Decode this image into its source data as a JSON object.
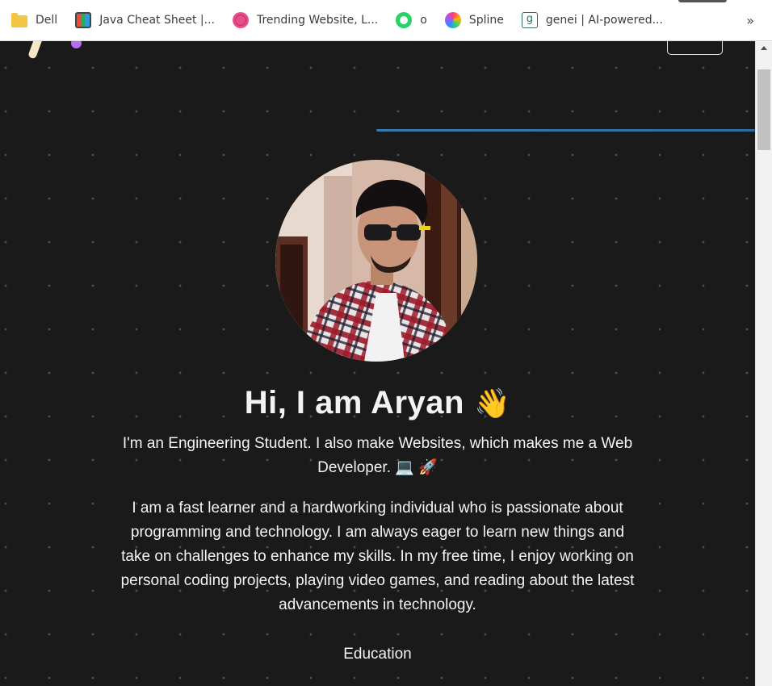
{
  "bookmarks_bar": {
    "items": [
      {
        "label": "Dell",
        "icon": "folder-icon"
      },
      {
        "label": "Java Cheat Sheet |...",
        "icon": "java-icon"
      },
      {
        "label": "Trending Website, L...",
        "icon": "dribbble-icon"
      },
      {
        "label": "o",
        "icon": "whatsapp-icon"
      },
      {
        "label": "Spline",
        "icon": "spline-icon"
      },
      {
        "label": "genei | AI-powered...",
        "icon": "genei-icon"
      }
    ],
    "more": "»"
  },
  "site": {
    "title": "Hi, I am Aryan",
    "title_emoji": "👋",
    "subtitle": "I'm an Engineering Student. I also make Websites, which makes me a Web Developer. 💻 🚀",
    "about": "I am a fast learner and a hardworking individual who is passionate about programming and technology. I am always eager to learn new things and take on challenges to enhance my skills. In my free time, I enjoy working on personal coding projects, playing video games, and reading about the latest advancements in technology.",
    "section_heading": "Education"
  },
  "colors": {
    "background": "#1a1a1a",
    "accent_line": "#3a7bb0",
    "logo_cream": "#f5e7c4",
    "logo_dot": "#b86cf0"
  }
}
